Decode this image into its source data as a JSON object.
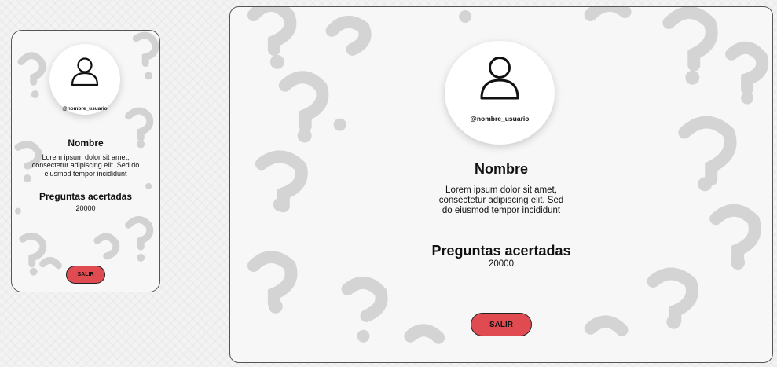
{
  "profile": {
    "username": "@nombre_usuario",
    "name": "Nombre",
    "description": "Lorem ipsum dolor sit amet, consectetur adipiscing elit. Sed do eiusmod tempor incididunt",
    "score_title": "Preguntas acertadas",
    "score_value": "20000",
    "logout_label": "SALIR"
  },
  "icons": {
    "avatar": "user-icon",
    "background_pattern": "question-mark-icon"
  },
  "colors": {
    "logout_button": "#e04b52",
    "card_background": "#ffffff",
    "pattern": "#cfcfcf"
  }
}
